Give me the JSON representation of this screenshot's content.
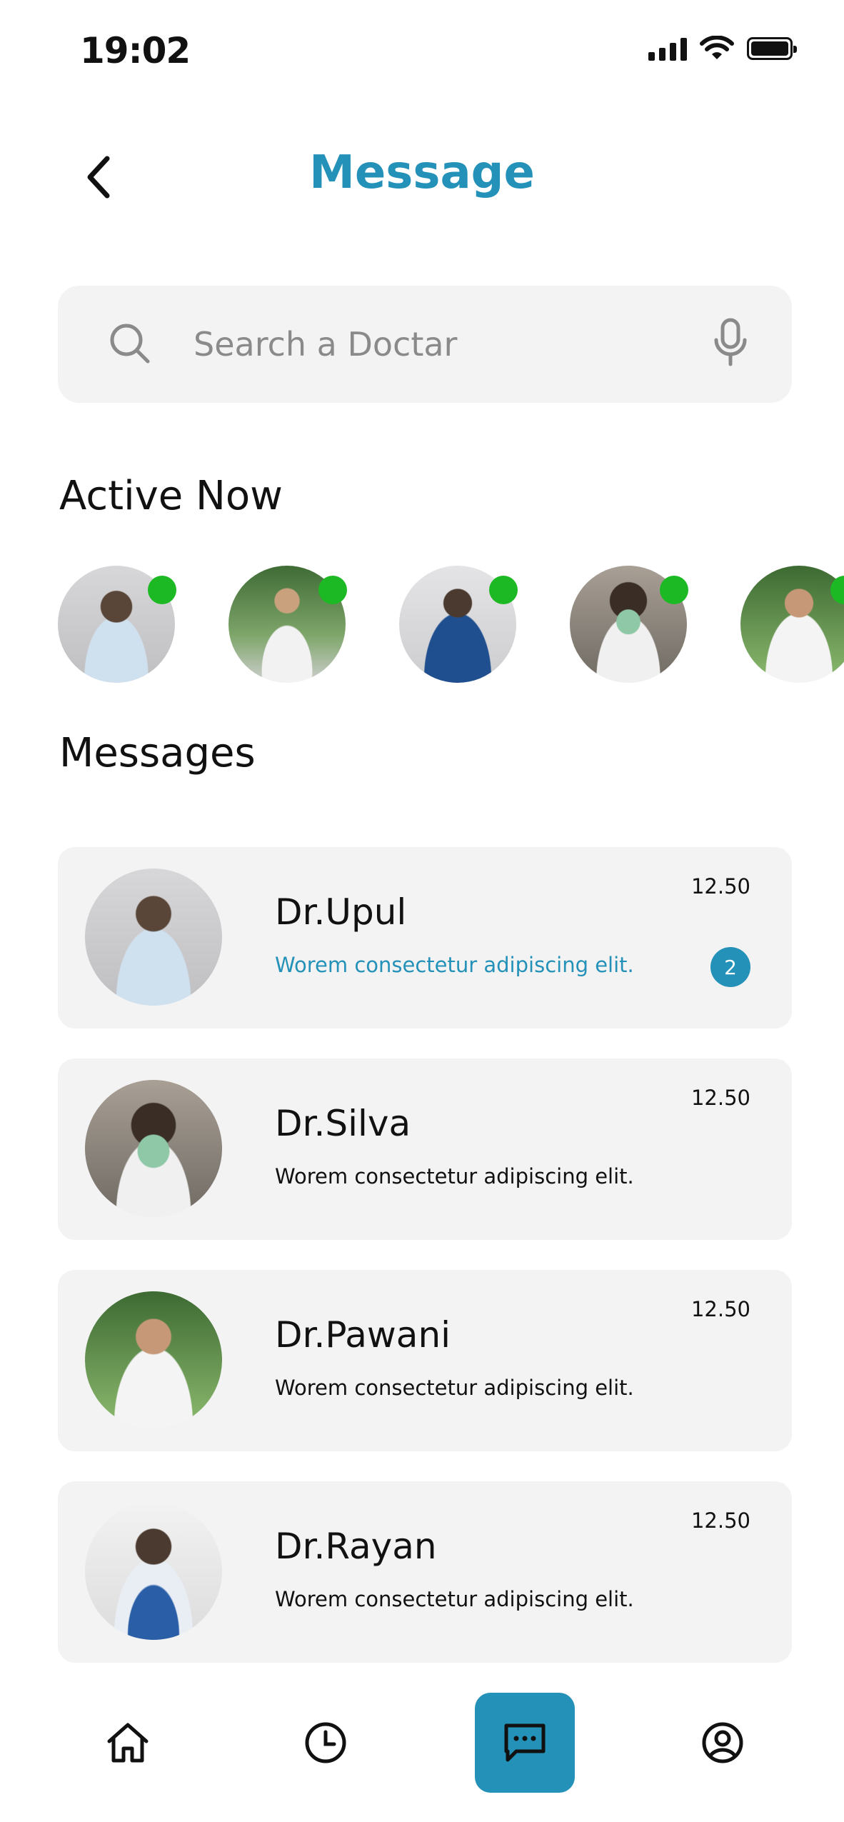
{
  "status_bar": {
    "time": "19:02"
  },
  "header": {
    "title": "Message",
    "back_icon": "chevron-left-icon"
  },
  "search": {
    "placeholder": "Search a Doctar",
    "icon": "search-icon",
    "mic_icon": "microphone-icon"
  },
  "sections": {
    "active_title": "Active Now",
    "messages_title": "Messages"
  },
  "colors": {
    "accent": "#2391B8",
    "online": "#1DB924",
    "card_bg": "#F3F3F3"
  },
  "active_now": [
    {
      "name": "doctor-1"
    },
    {
      "name": "doctor-2"
    },
    {
      "name": "doctor-3"
    },
    {
      "name": "doctor-4"
    },
    {
      "name": "doctor-5"
    }
  ],
  "messages": [
    {
      "name": "Dr.Upul",
      "preview": "Worem consectetur adipiscing elit.",
      "time": "12.50",
      "unread": "2"
    },
    {
      "name": "Dr.Silva",
      "preview": "Worem consectetur adipiscing elit.",
      "time": "12.50"
    },
    {
      "name": "Dr.Pawani",
      "preview": "Worem consectetur adipiscing elit.",
      "time": "12.50"
    },
    {
      "name": "Dr.Rayan",
      "preview": "Worem consectetur adipiscing elit.",
      "time": "12.50"
    }
  ],
  "nav": [
    {
      "icon": "home-icon"
    },
    {
      "icon": "clock-icon"
    },
    {
      "icon": "chat-icon",
      "active": true
    },
    {
      "icon": "profile-icon"
    }
  ]
}
